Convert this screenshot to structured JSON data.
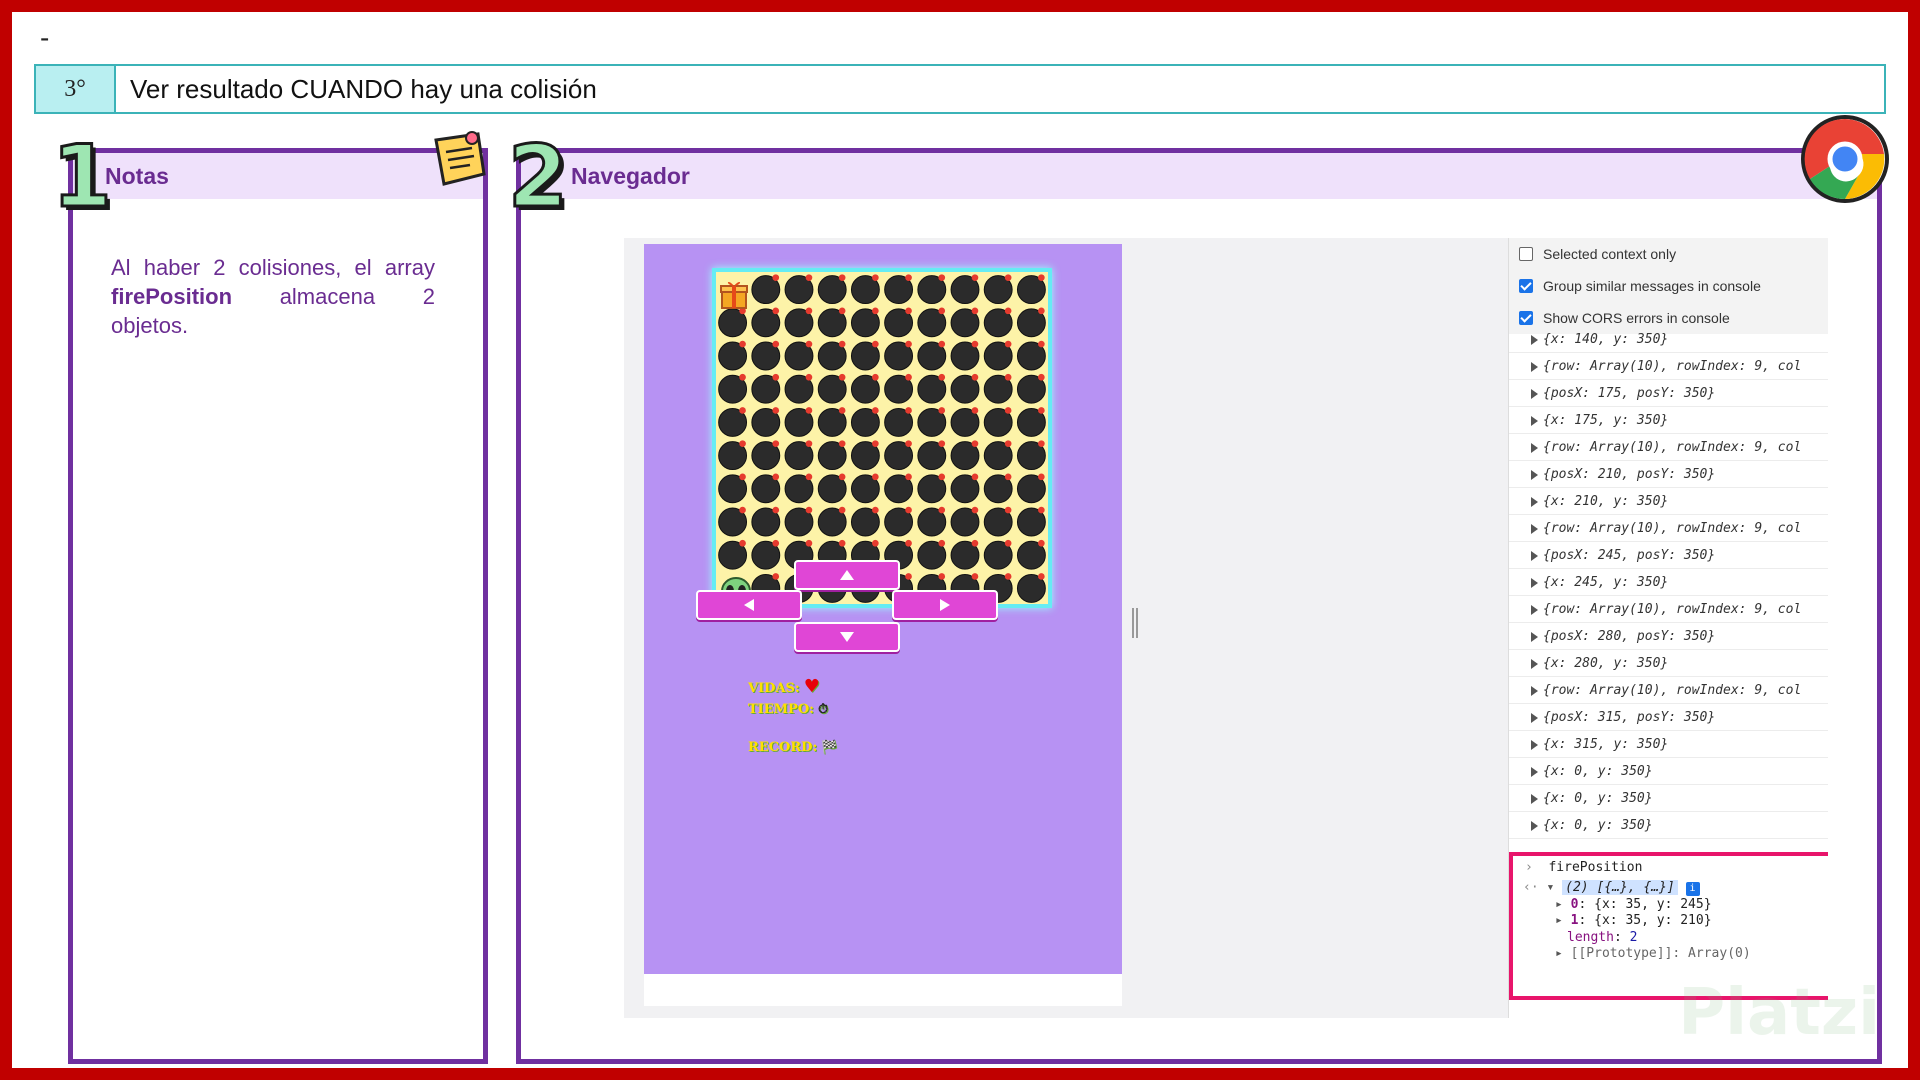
{
  "top": {
    "dash": "-"
  },
  "step": {
    "number": "3°",
    "title": "Ver resultado CUANDO hay una colisión"
  },
  "notes": {
    "badge": "1",
    "title": "Notas",
    "text_before": "Al haber 2 colisiones, el array",
    "text_bold": "firePosition",
    "text_after": "almacena 2 objetos."
  },
  "navegador": {
    "badge": "2",
    "title": "Navegador"
  },
  "game": {
    "grid_size": 10,
    "colors": {
      "bg": "#b792f3",
      "board": "#fdf3a8",
      "border": "#66ecf3",
      "button": "#e046d6",
      "hud": "#ffe000"
    },
    "hud": {
      "vidas": "VIDAS:",
      "vidas_icon": "♥",
      "tiempo": "TIEMPO:",
      "tiempo_icon": "⏱",
      "record": "RECORD:",
      "record_icon": "🏁"
    },
    "buttons": [
      "up",
      "left",
      "right",
      "down"
    ]
  },
  "devtools": {
    "settings": [
      {
        "label": "Selected context only",
        "checked": false
      },
      {
        "label": "Group similar messages in console",
        "checked": true
      },
      {
        "label": "Show CORS errors in console",
        "checked": true
      }
    ],
    "logs": [
      "{x: 140, y: 350}",
      "{row: Array(10), rowIndex: 9, col",
      "{posX: 175, posY: 350}",
      "{x: 175, y: 350}",
      "{row: Array(10), rowIndex: 9, col",
      "{posX: 210, posY: 350}",
      "{x: 210, y: 350}",
      "{row: Array(10), rowIndex: 9, col",
      "{posX: 245, posY: 350}",
      "{x: 245, y: 350}",
      "{row: Array(10), rowIndex: 9, col",
      "{posX: 280, posY: 350}",
      "{x: 280, y: 350}",
      "{row: Array(10), rowIndex: 9, col",
      "{posX: 315, posY: 350}",
      "{x: 315, y: 350}",
      "{x: 0, y: 350}",
      "{x: 0, y: 350}",
      "{x: 0, y: 350}"
    ],
    "console": {
      "input": "firePosition",
      "result_summary": "(2) [{…}, {…}]",
      "item0": "{x: 35, y: 245}",
      "item1": "{x: 35, y: 210}",
      "length_label": "length",
      "length_value": "2",
      "prototype": "[[Prototype]]: Array(0)"
    }
  },
  "watermark": "Platzi"
}
